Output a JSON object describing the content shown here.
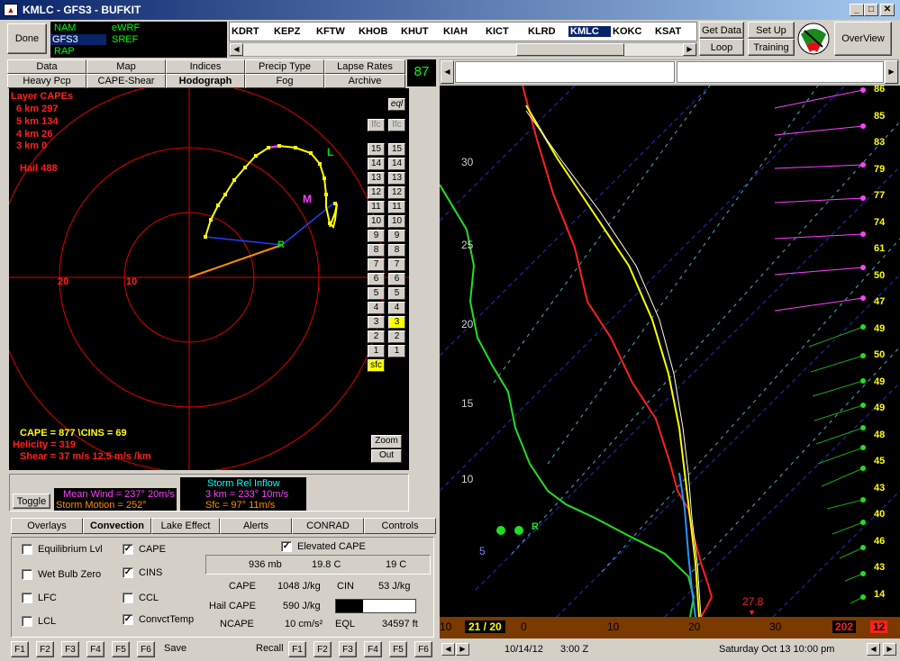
{
  "window": {
    "title": "KMLC - GFS3 - BUFKIT",
    "min": "_",
    "max": "□",
    "close": "✕"
  },
  "toolbar": {
    "done": "Done",
    "get_data": "Get Data",
    "loop": "Loop",
    "setup": "Set Up",
    "training": "Training",
    "overview": "OverView"
  },
  "models": [
    {
      "label": "NAM",
      "color": "#00ff00"
    },
    {
      "label": "eWRF",
      "color": "#00ff00"
    },
    {
      "label": "GFS3",
      "color": "#ffffff",
      "selected": true
    },
    {
      "label": "SREF",
      "color": "#00ff00"
    },
    {
      "label": "RAP",
      "color": "#00ff00"
    }
  ],
  "stations": [
    "KDRT",
    "KEPZ",
    "KFTW",
    "KHOB",
    "KHUT",
    "KIAH",
    "KICT",
    "KLRD",
    "KMLC",
    "KOKC",
    "KSAT"
  ],
  "selected_station": "KMLC",
  "tabs_row1": [
    "Data",
    "Map",
    "Indices",
    "Precip Type",
    "Lapse Rates"
  ],
  "tabs_row2": [
    "Heavy Pcp",
    "CAPE-Shear",
    "Hodograph",
    "Fog",
    "Archive"
  ],
  "selected_tab": "Hodograph",
  "hour_box": "87",
  "hodograph": {
    "layer_cape_title": "Layer CAPEs",
    "layer_capes": [
      "6 km  297",
      "5 km  134",
      "4 km  26",
      "3 km  0"
    ],
    "hail": "Hail 488",
    "ring_labels": [
      "20",
      "10"
    ],
    "marker_L": "L",
    "marker_M": "M",
    "marker_R": "R",
    "eql": "eql",
    "lfc": "lfc",
    "levels": [
      "15",
      "14",
      "13",
      "12",
      "11",
      "10",
      "9",
      "8",
      "7",
      "6",
      "5",
      "4",
      "3",
      "2",
      "1"
    ],
    "highlight_level": "3",
    "sfc": "sfc",
    "cape_line": "CAPE =  877 \\CINS =  69",
    "helicity": "Helicity =  319",
    "shear": "Shear =  37 m/s    12.5 m/s /km",
    "zoom": "Zoom",
    "out": "Out"
  },
  "wind_panel": {
    "toggle": "Toggle",
    "mean_wind": "Mean Wind = 237°  20m/s",
    "storm_motion": "Storm Motion = 252°",
    "inflow_title": "Storm Rel Inflow",
    "inflow_3km": "3 km = 233°  10m/s",
    "inflow_sfc": "Sfc  = 97°  11m/s"
  },
  "subtabs": [
    "Overlays",
    "Convection",
    "Lake Effect",
    "Alerts",
    "CONRAD",
    "Controls"
  ],
  "selected_subtab": "Convection",
  "checks": [
    {
      "label": "Equilibrium Lvl",
      "checked": false
    },
    {
      "label": "CAPE",
      "checked": true
    },
    {
      "label": "Wet Bulb Zero",
      "checked": false
    },
    {
      "label": "CINS",
      "checked": true
    },
    {
      "label": "LFC",
      "checked": false
    },
    {
      "label": "CCL",
      "checked": false
    },
    {
      "label": "LCL",
      "checked": false
    },
    {
      "label": "ConvctTemp",
      "checked": true
    }
  ],
  "elevated": {
    "label": "Elevated CAPE",
    "checked": true
  },
  "parcel": {
    "pressure": "936 mb",
    "temp": "19.8 C",
    "dew": "19 C"
  },
  "stats": {
    "cape_label": "CAPE",
    "cape_val": "1048 J/kg",
    "cin_label": "CIN",
    "cin_val": "53 J/kg",
    "hail_label": "Hail CAPE",
    "hail_val": "590 J/kg",
    "ncape_label": "NCAPE",
    "ncape_val": "10 cm/s²",
    "eql_label": "EQL",
    "eql_val": "34597 ft"
  },
  "fkeys_left": [
    "F1",
    "F2",
    "F3",
    "F4",
    "F5",
    "F6"
  ],
  "save": "Save",
  "recall": "Recall",
  "fkeys_right": [
    "F1",
    "F2",
    "F3",
    "F4",
    "F5",
    "F6"
  ],
  "sounding": {
    "height_labels": [
      "30",
      "25",
      "20",
      "15",
      "10",
      "5"
    ],
    "temp_axis": [
      "10",
      "0",
      "10",
      "20",
      "30"
    ],
    "axis_left": "21 / 20",
    "surface_temp": "27.8",
    "axis_right": "202",
    "axis_far_right": "12",
    "marker_R": "R",
    "wind_speeds": [
      "86",
      "85",
      "83",
      "79",
      "77",
      "74",
      "61",
      "50",
      "47",
      "49",
      "50",
      "49",
      "49",
      "48",
      "45",
      "43",
      "40",
      "46",
      "43",
      "14"
    ]
  },
  "status": {
    "date": "10/14/12",
    "time": "3:00 Z",
    "local": "Saturday   Oct 13  10:00 pm"
  }
}
